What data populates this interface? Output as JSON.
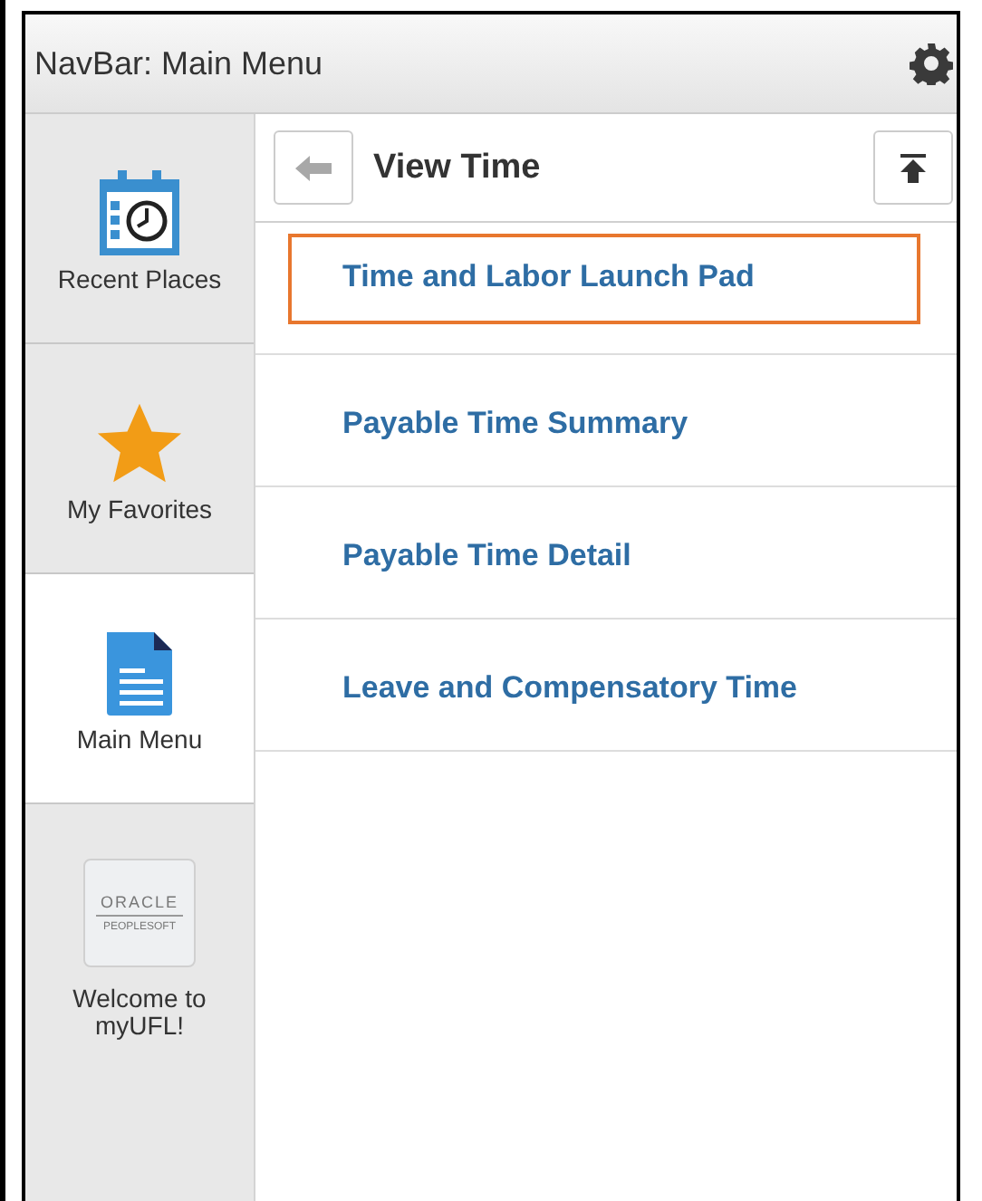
{
  "navbar": {
    "title": "NavBar: Main Menu"
  },
  "sidebar": {
    "items": [
      {
        "kind": "calendar",
        "label": "Recent Places",
        "selected": false
      },
      {
        "kind": "star",
        "label": "My Favorites",
        "selected": false
      },
      {
        "kind": "document",
        "label": "Main Menu",
        "selected": true
      },
      {
        "kind": "logo",
        "label": "Welcome to myUFL!",
        "logo_lines": [
          "ORACLE",
          "PEOPLESOFT"
        ],
        "selected": false
      }
    ]
  },
  "panel": {
    "title": "View Time",
    "items": [
      {
        "label": "Time and Labor Launch Pad",
        "focused": true
      },
      {
        "label": "Payable Time Summary",
        "focused": false
      },
      {
        "label": "Payable Time Detail",
        "focused": false
      },
      {
        "label": "Leave and Compensatory Time",
        "focused": false
      }
    ]
  }
}
